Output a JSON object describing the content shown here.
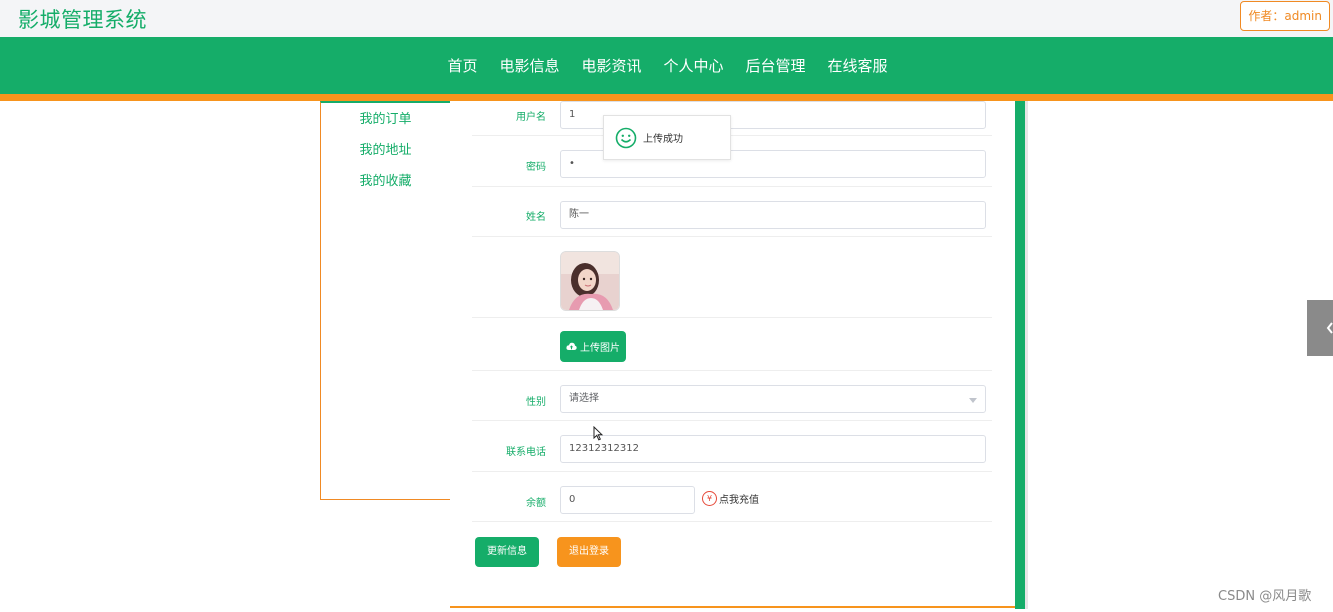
{
  "header": {
    "site_title": "影城管理系统",
    "author_badge": "作者：admin"
  },
  "nav": {
    "items": [
      "首页",
      "电影信息",
      "电影资讯",
      "个人中心",
      "后台管理",
      "在线客服"
    ]
  },
  "sidebar": {
    "items": [
      "我的订单",
      "我的地址",
      "我的收藏"
    ]
  },
  "form": {
    "username": {
      "label": "用户名",
      "value": "1"
    },
    "password": {
      "label": "密码",
      "value": "•"
    },
    "name": {
      "label": "姓名",
      "value": "陈一"
    },
    "upload_button": "上传图片",
    "gender": {
      "label": "性别",
      "placeholder": "请选择"
    },
    "phone": {
      "label": "联系电话",
      "value": "12312312312"
    },
    "balance": {
      "label": "余额",
      "value": "0"
    },
    "recharge_link": "点我充值",
    "recharge_symbol": "¥",
    "update_button": "更新信息",
    "logout_button": "退出登录"
  },
  "toast": {
    "message": "上传成功"
  },
  "watermark": "CSDN @风月歌",
  "colors": {
    "primary_green": "#15ad69",
    "accent_orange": "#f7941d"
  },
  "icons": {
    "toast_icon": "smile-icon",
    "upload_icon": "cloud-upload-icon",
    "side_tab_icon": "chevron-left-icon"
  }
}
